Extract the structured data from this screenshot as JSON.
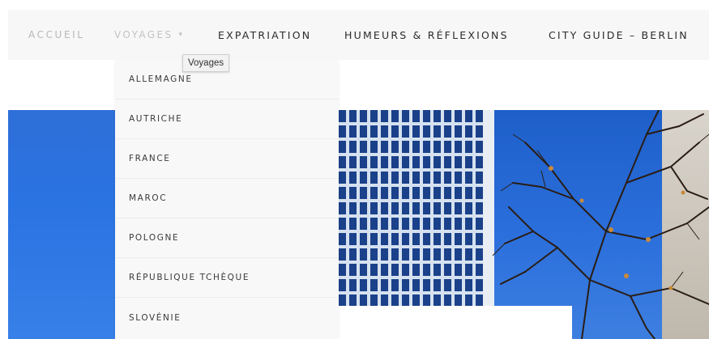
{
  "nav": {
    "items": [
      {
        "label": "ACCUEIL"
      },
      {
        "label": "VOYAGES"
      },
      {
        "label": "EXPATRIATION"
      },
      {
        "label": "HUMEURS & RÉFLEXIONS"
      },
      {
        "label": "CITY GUIDE – BERLIN"
      }
    ],
    "caret": "▾"
  },
  "dropdown": {
    "items": [
      {
        "label": "ALLEMAGNE"
      },
      {
        "label": "AUTRICHE"
      },
      {
        "label": "FRANCE"
      },
      {
        "label": "MAROC"
      },
      {
        "label": "POLOGNE"
      },
      {
        "label": "RÉPUBLIQUE TCHÈQUE"
      },
      {
        "label": "SLOVÉNIE"
      }
    ]
  },
  "tooltip": {
    "text": "Voyages"
  },
  "colors": {
    "sky": "#2a73e2",
    "nav_bg": "#f7f7f7",
    "dropdown_bg": "#f8f8f8"
  }
}
